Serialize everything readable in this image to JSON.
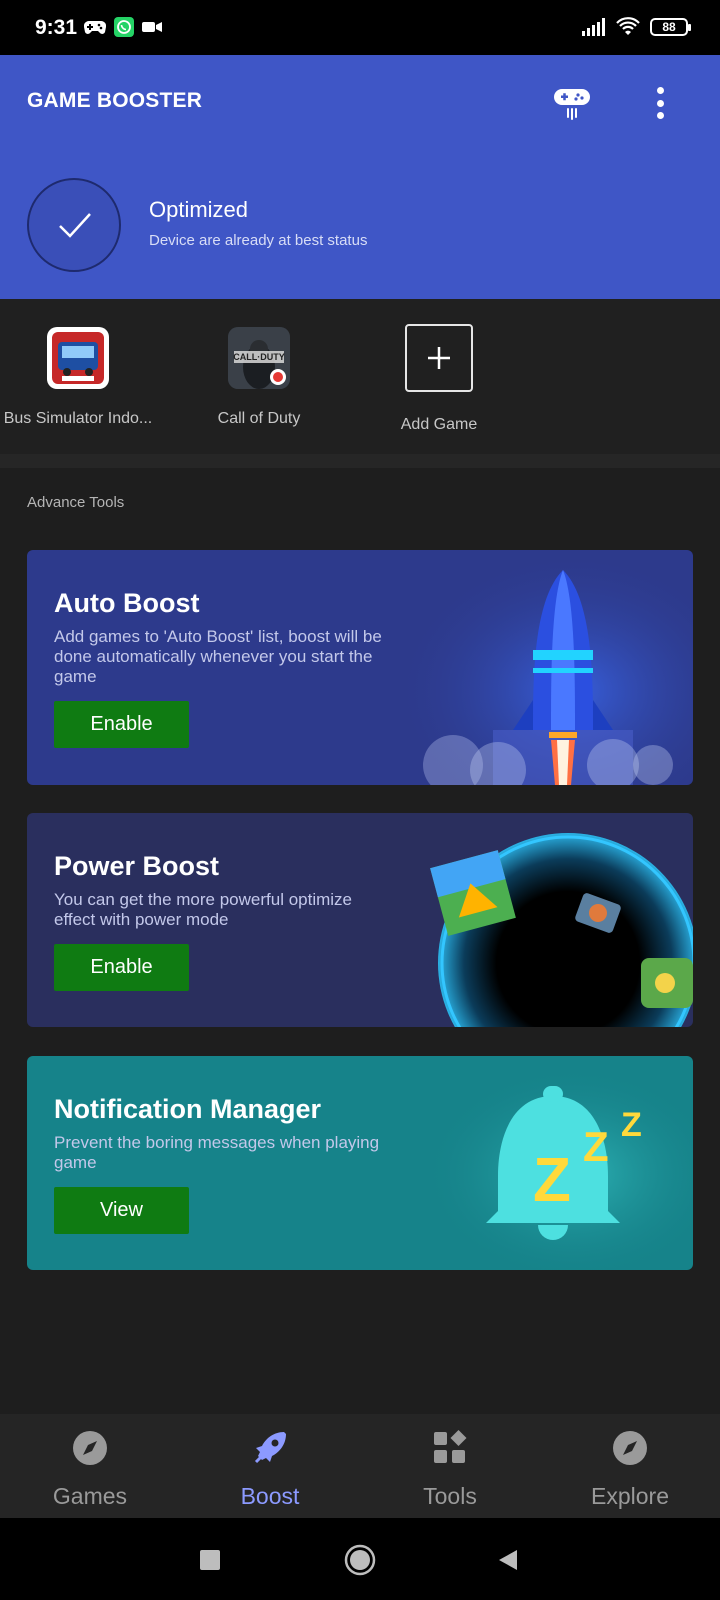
{
  "status_bar": {
    "time": "9:31",
    "battery": "88",
    "left_icons": [
      "gamepad-icon",
      "whatsapp-icon",
      "video-icon"
    ],
    "right_icons": [
      "signal-icon",
      "wifi-icon",
      "battery-icon"
    ]
  },
  "header": {
    "title": "GAME BOOSTER",
    "status_title": "Optimized",
    "status_subtitle": "Device are already at best status",
    "bg_color": "#3f56c6"
  },
  "games": [
    {
      "label": "Bus Simulator Indo..."
    },
    {
      "label": "Call of Duty"
    },
    {
      "label": "Add Game"
    }
  ],
  "section_title": "Advance Tools",
  "cards": [
    {
      "title": "Auto Boost",
      "description": "Add games to 'Auto Boost' list, boost will be done automatically whenever you start the game",
      "button": "Enable"
    },
    {
      "title": "Power Boost",
      "description": "You can get the more powerful optimize effect with power mode",
      "button": "Enable"
    },
    {
      "title": "Notification Manager",
      "description": "Prevent the boring messages when playing game",
      "button": "View"
    }
  ],
  "bottom_nav": [
    {
      "label": "Games",
      "icon": "compass-icon"
    },
    {
      "label": "Boost",
      "icon": "rocket-icon",
      "active": true
    },
    {
      "label": "Tools",
      "icon": "tools-icon"
    },
    {
      "label": "Explore",
      "icon": "compass-icon"
    }
  ],
  "colors": {
    "accent": "#8c9aff",
    "button_green": "#0f7b12",
    "card_auto": "#2d3a8c",
    "card_power": "#2a2f5e",
    "card_notify": "#16838a"
  }
}
